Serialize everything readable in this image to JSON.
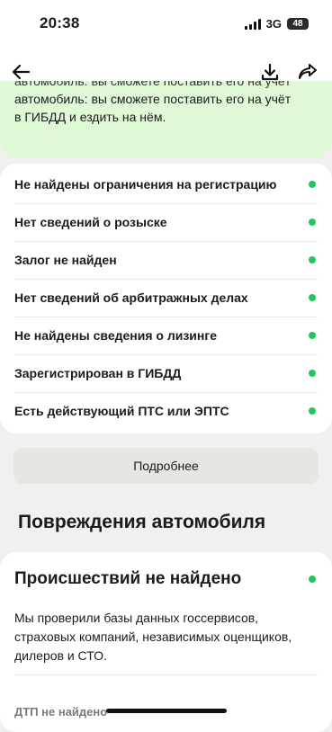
{
  "status_bar": {
    "time": "20:38",
    "network": "3G",
    "battery": "48"
  },
  "toolbar": {
    "back_icon": "arrow-left-icon",
    "download_icon": "download-icon",
    "share_icon": "share-icon"
  },
  "summary": {
    "cut_line": "автомобиль: вы сможете поставить его на учёт",
    "line1": "автомобиль: вы сможете поставить его на учёт",
    "line2": "в ГИБДД и ездить на нём."
  },
  "checks": [
    {
      "label": "Не найдены ограничения на регистрацию",
      "status": "ok"
    },
    {
      "label": "Нет сведений о розыске",
      "status": "ok"
    },
    {
      "label": "Залог не найден",
      "status": "ok"
    },
    {
      "label": "Нет сведений об арбитражных делах",
      "status": "ok"
    },
    {
      "label": "Не найдены сведения о лизинге",
      "status": "ok"
    },
    {
      "label": "Зарегистрирован в ГИБДД",
      "status": "ok"
    },
    {
      "label": "Есть действующий ПТС или ЭПТС",
      "status": "ok"
    }
  ],
  "more_button": "Подробнее",
  "damage_section": {
    "title": "Повреждения автомобиля",
    "card_title": "Происшествий не найдено",
    "description": "Мы проверили базы данных госсервисов, страховых компаний, независимых оценщиков, дилеров и СТО.",
    "dtp_label": "ДТП не найдено"
  },
  "colors": {
    "accent_green": "#22c55e",
    "summary_bg": "#dff8d6",
    "page_bg": "#f1f0ee"
  }
}
